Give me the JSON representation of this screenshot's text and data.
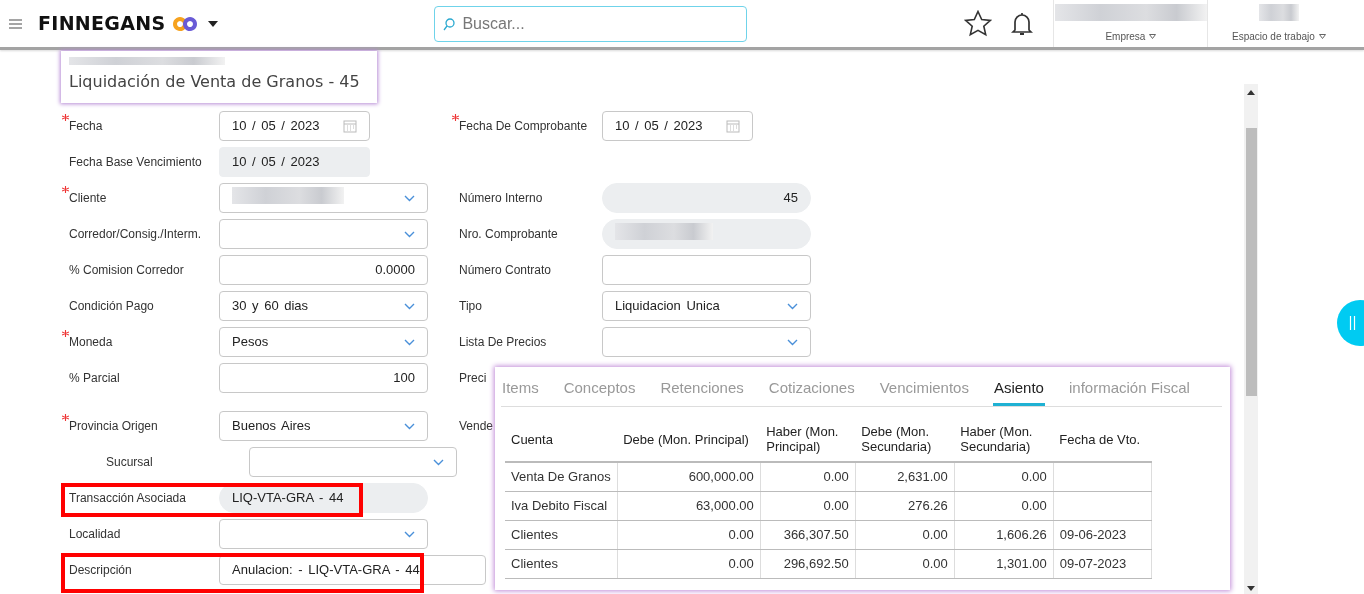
{
  "header": {
    "brand": "FINNEGANS",
    "search": {
      "placeholder": "Buscar..."
    },
    "company_label": "Empresa",
    "workspace_label": "Espacio de trabajo"
  },
  "document": {
    "title": "Liquidación de Venta de Granos - 45"
  },
  "form_rows": [
    {
      "left": {
        "label": "Fecha",
        "required": true,
        "kind": "date",
        "value": "10 / 05 / 2023",
        "disabled": false
      },
      "right": {
        "label": "Fecha De Comprobante",
        "required": true,
        "kind": "date",
        "value": "10 / 05 / 2023",
        "disabled": false
      }
    },
    {
      "left": {
        "label": "Fecha Base Vencimiento",
        "required": false,
        "kind": "date",
        "value": "10 / 05 / 2023",
        "disabled": true
      }
    },
    {
      "left": {
        "label": "Cliente",
        "required": true,
        "kind": "select",
        "value_blurred": true
      },
      "right": {
        "label": "Número Interno",
        "required": false,
        "kind": "readonly-number",
        "value": "45"
      }
    },
    {
      "left": {
        "label": "Corredor/Consig./Interm.",
        "required": false,
        "kind": "select"
      },
      "right": {
        "label": "Nro. Comprobante",
        "required": false,
        "kind": "readonly",
        "value_blurred": true
      }
    },
    {
      "left": {
        "label": "% Comision Corredor",
        "required": false,
        "kind": "number",
        "value": "0.0000"
      },
      "right": {
        "label": "Número Contrato",
        "required": false,
        "kind": "text"
      }
    },
    {
      "left": {
        "label": "Condición Pago",
        "required": false,
        "kind": "select",
        "value": "30 y 60 dias"
      },
      "right": {
        "label": "Tipo",
        "required": false,
        "kind": "select",
        "value": "Liquidacion Unica"
      }
    },
    {
      "left": {
        "label": "Moneda",
        "required": true,
        "kind": "select",
        "value": "Pesos"
      },
      "right": {
        "label": "Lista De Precios",
        "required": false,
        "kind": "select"
      }
    },
    {
      "left": {
        "label": "% Parcial",
        "required": false,
        "kind": "number",
        "value": "100"
      },
      "right": {
        "label": "Preci",
        "required": false,
        "kind": "label"
      }
    },
    {
      "left": {
        "label": "Provincia Origen",
        "required": true,
        "kind": "select",
        "value": "Buenos Aires"
      },
      "right": {
        "label": "Vende",
        "required": false,
        "kind": "label"
      }
    },
    {
      "kind": "sub",
      "left": {
        "label": "Sucursal",
        "required": false,
        "kind": "select"
      }
    },
    {
      "left": {
        "label": "Transacción Asociada",
        "required": false,
        "kind": "readonly",
        "value": "LIQ-VTA-GRA - 44",
        "highlighted": true
      }
    },
    {
      "left": {
        "label": "Localidad",
        "required": false,
        "kind": "select"
      }
    },
    {
      "left": {
        "label": "Descripción",
        "required": false,
        "kind": "wide-text",
        "value": "Anulacion: - LIQ-VTA-GRA - 44",
        "highlighted": true
      }
    }
  ],
  "detail_panel": {
    "tabs": [
      {
        "label": "Items",
        "selected": false
      },
      {
        "label": "Conceptos",
        "selected": false
      },
      {
        "label": "Retenciones",
        "selected": false
      },
      {
        "label": "Cotizaciones",
        "selected": false
      },
      {
        "label": "Vencimientos",
        "selected": false
      },
      {
        "label": "Asiento",
        "selected": true
      },
      {
        "label": "información Fiscal",
        "selected": false
      }
    ],
    "table": {
      "columns": [
        "Cuenta",
        "Debe (Mon. Principal)",
        "Haber (Mon. Principal)",
        "Debe (Mon. Secundaria)",
        "Haber (Mon. Secundaria)",
        "Fecha de Vto."
      ],
      "rows": [
        [
          "Venta De Granos",
          "600,000.00",
          "0.00",
          "2,631.00",
          "0.00",
          ""
        ],
        [
          "Iva Debito Fiscal",
          "63,000.00",
          "0.00",
          "276.26",
          "0.00",
          ""
        ],
        [
          "Clientes",
          "0.00",
          "366,307.50",
          "0.00",
          "1,606.26",
          "09-06-2023"
        ],
        [
          "Clientes",
          "0.00",
          "296,692.50",
          "0.00",
          "1,301.00",
          "09-07-2023"
        ]
      ]
    }
  }
}
